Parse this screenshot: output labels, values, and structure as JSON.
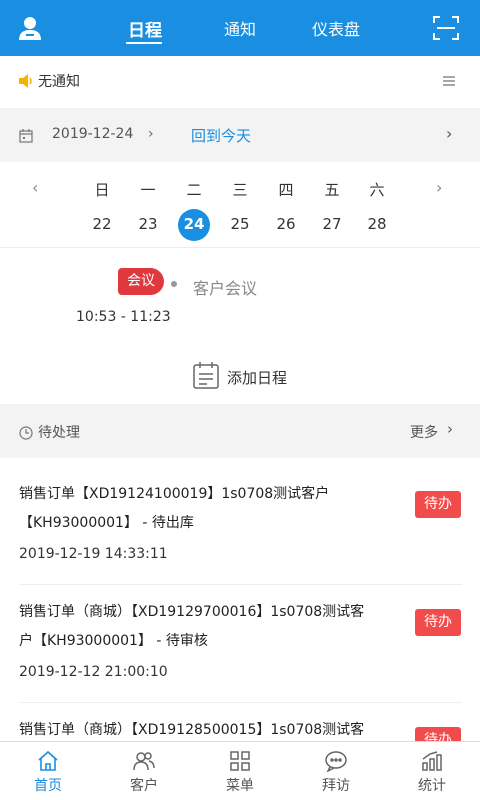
{
  "header": {
    "tabs": [
      "日程",
      "通知",
      "仪表盘"
    ],
    "active_tab": "日程",
    "accent": "#1a8ee1"
  },
  "notice": {
    "text": "无通知"
  },
  "date_bar": {
    "date": "2019-12-24",
    "today_link": "回到今天"
  },
  "week": {
    "weekdays": [
      "日",
      "一",
      "二",
      "三",
      "四",
      "五",
      "六"
    ],
    "days": [
      "22",
      "23",
      "24",
      "25",
      "26",
      "27",
      "28"
    ],
    "selected_day": "24"
  },
  "event": {
    "tag": "会议",
    "title": "客户会议",
    "time": "10:53 - 11:23"
  },
  "add_schedule": {
    "label": "添加日程"
  },
  "pending": {
    "title": "待处理",
    "more": "更多",
    "items": [
      {
        "line1": "销售订单【XD19124100019】1s0708测试客户",
        "line2": "【KH93000001】 - 待出库",
        "timestamp": "2019-12-19 14:33:11",
        "badge": "待办"
      },
      {
        "line1": "销售订单（商城）【XD19129700016】1s0708测试客",
        "line2": "户【KH93000001】 - 待审核",
        "timestamp": "2019-12-12 21:00:10",
        "badge": "待办"
      },
      {
        "line1": "销售订单（商城）【XD19128500015】1s0708测试客",
        "line2": "",
        "timestamp": "",
        "badge": "待办"
      }
    ]
  },
  "bottom_nav": {
    "items": [
      "首页",
      "客户",
      "菜单",
      "拜访",
      "统计"
    ],
    "active": "首页"
  }
}
